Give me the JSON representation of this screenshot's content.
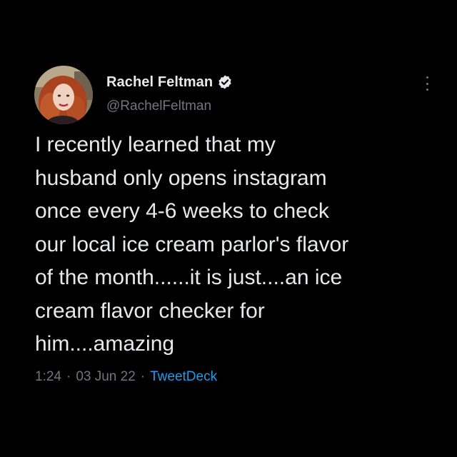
{
  "tweet": {
    "author": {
      "display_name": "Rachel Feltman",
      "handle": "@RachelFeltman",
      "verified_icon": "verified-badge-icon"
    },
    "text_lines": [
      "I recently learned that my",
      "husband only opens instagram",
      "once every 4-6 weeks to check",
      "our local ice cream parlor's flavor",
      "of the month......it is just....an ice",
      "cream flavor checker for",
      "him....amazing"
    ],
    "meta": {
      "time": "1:24",
      "separator": "·",
      "date": "03 Jun 22",
      "source": "TweetDeck"
    },
    "more_icon": "more-vertical-icon"
  },
  "colors": {
    "background": "#000000",
    "primary_text": "#e7e9ea",
    "secondary_text": "#71767b",
    "link": "#1d9bf0"
  }
}
